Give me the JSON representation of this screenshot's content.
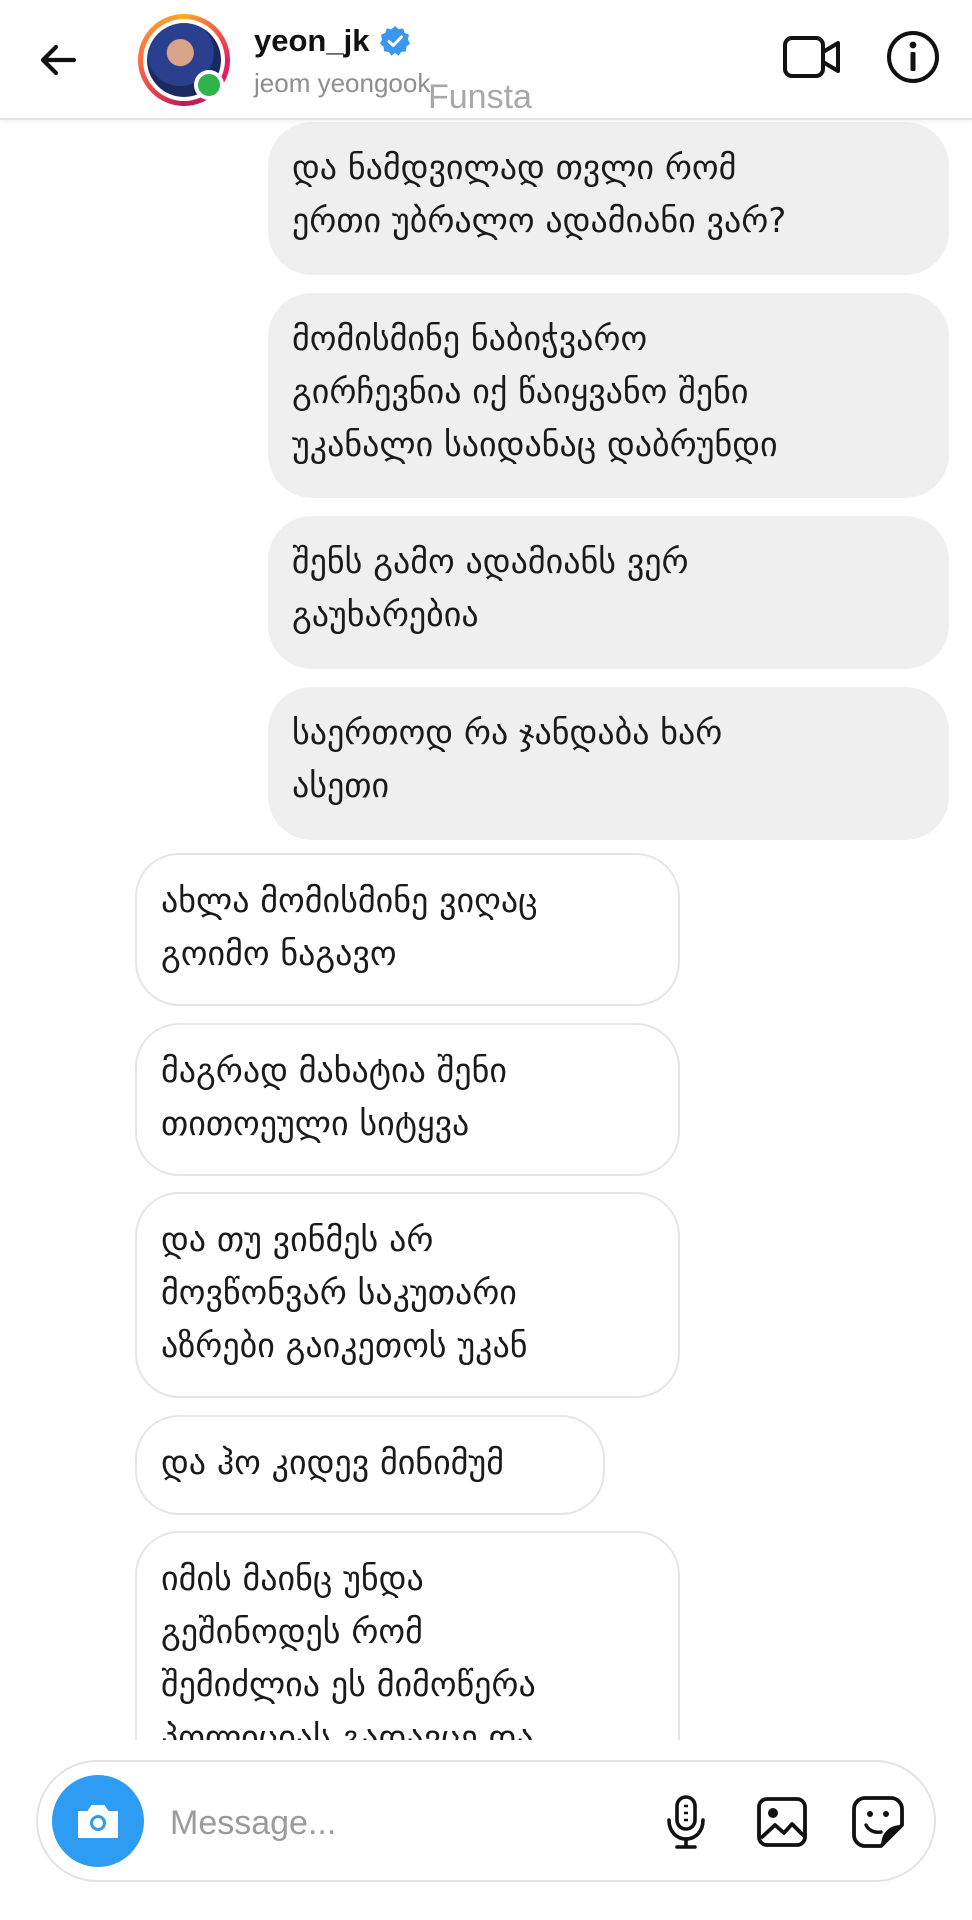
{
  "header": {
    "username": "yeon_jk",
    "subname": "jeom yeongook",
    "watermark": "Funsta"
  },
  "icons": {
    "back": "arrow-left-icon",
    "verified": "verified-badge-icon",
    "video": "video-camera-icon",
    "info": "info-icon",
    "camera": "camera-icon",
    "mic": "microphone-icon",
    "gallery": "image-icon",
    "sticker": "sticker-icon"
  },
  "colors": {
    "verified": "#3897f0",
    "camera_button": "#2d9cf2",
    "online": "#2fb34a",
    "sent_bubble": "#efefef"
  },
  "messages": [
    {
      "direction": "sent",
      "text": "და ნამდვილად თვლი რომ\nერთი უბრალო ადამიანი ვარ?"
    },
    {
      "direction": "sent",
      "text": "მომისმინე ნაბიჭვარო\nგირჩევნია იქ წაიყვანო შენი\nუკანალი საიდანაც დაბრუნდი"
    },
    {
      "direction": "sent",
      "text": "შენს გამო ადამიანს ვერ\nგაუხარებია"
    },
    {
      "direction": "sent",
      "text": "საერთოდ რა ჯანდაბა ხარ\nასეთი"
    },
    {
      "direction": "received",
      "text": "ახლა მომისმინე ვიღაც\nგოიმო ნაგავო"
    },
    {
      "direction": "received",
      "text": "მაგრად მახატია შენი\nთითოეული სიტყვა"
    },
    {
      "direction": "received",
      "text": "და თუ ვინმეს არ\nმოვწონვარ საკუთარი\nაზრები გაიკეთოს უკან"
    },
    {
      "direction": "received",
      "text": "და ჰო კიდევ მინიმუმ"
    },
    {
      "direction": "received",
      "text": "იმის მაინც უნდა\nგეშინოდეს რომ\nშემიძლია ეს მიმოწერა\nპოლიციას გადავცე და"
    }
  ],
  "composer": {
    "placeholder": "Message..."
  }
}
